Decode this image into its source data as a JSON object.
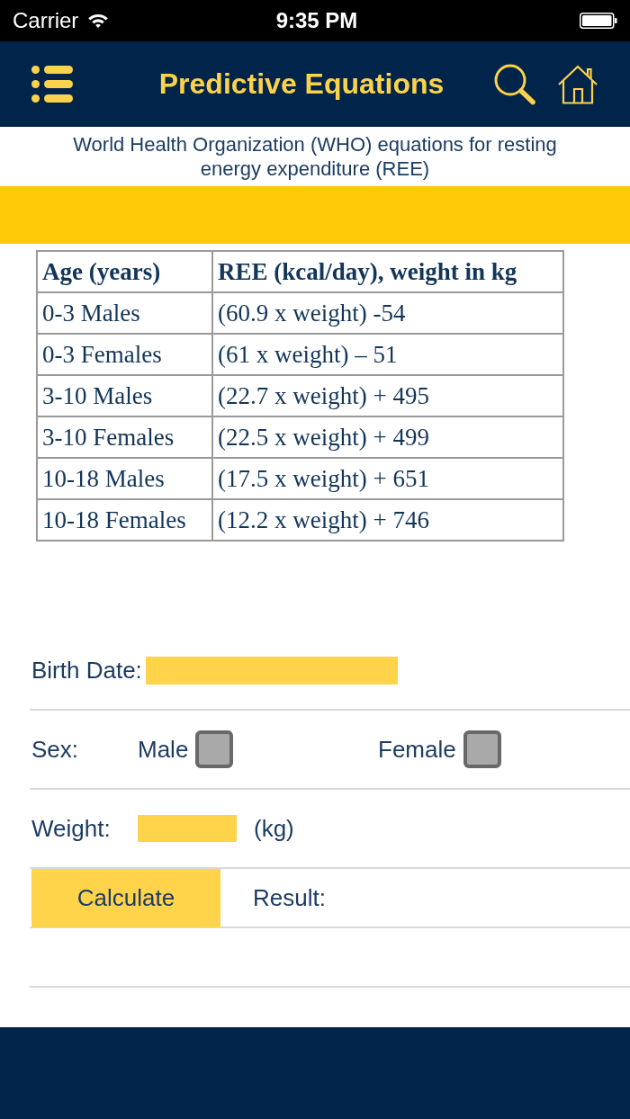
{
  "status_bar": {
    "carrier": "Carrier",
    "time": "9:35 PM"
  },
  "nav_bar": {
    "title": "Predictive Equations"
  },
  "subtitle": "World Health Organization (WHO) equations for resting energy expenditure (REE)",
  "table": {
    "columns": [
      "Age (years)",
      "REE (kcal/day), weight in kg"
    ],
    "rows": [
      [
        "0-3 Males",
        "(60.9 x weight) -54"
      ],
      [
        "0-3 Females",
        "(61 x weight) – 51"
      ],
      [
        "3-10 Males",
        "(22.7 x weight) + 495"
      ],
      [
        "3-10 Females",
        "(22.5 x weight) + 499"
      ],
      [
        "10-18 Males",
        "(17.5 x weight) + 651"
      ],
      [
        "10-18 Females",
        "(12.2 x weight) + 746"
      ]
    ]
  },
  "form": {
    "birth_date": {
      "label": "Birth Date:"
    },
    "sex": {
      "label": "Sex:",
      "options": [
        {
          "label": "Male",
          "checked": false
        },
        {
          "label": "Female",
          "checked": false
        }
      ]
    },
    "weight": {
      "label": "Weight:",
      "unit": "(kg)"
    },
    "calculate_button": "Calculate",
    "result_label": "Result:"
  }
}
